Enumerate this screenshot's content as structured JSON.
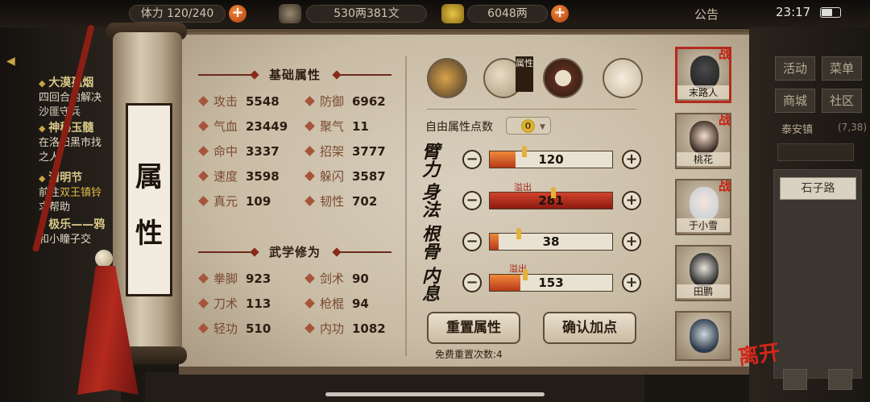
{
  "topbar": {
    "stamina_prefix": "体力",
    "stamina": "120/240",
    "money": "530两381文",
    "gold": "6048两",
    "announcement": "公告",
    "time": "23:17"
  },
  "quests": [
    {
      "title": "大漠孤烟",
      "lines": [
        "四回合内解决",
        "沙匪守兵"
      ]
    },
    {
      "title": "神秘玉髓",
      "lines": [
        "在洛阳黑市找",
        "之人"
      ]
    },
    {
      "title": "清明节",
      "lines": [
        "前往",
        "双王镇铃",
        "求帮助"
      ]
    },
    {
      "title": "极乐——鸦",
      "lines": [
        "和小瞳子交"
      ]
    }
  ],
  "scroll_title": [
    "属",
    "性"
  ],
  "basic": {
    "header": "基础属性",
    "stats": [
      {
        "label": "攻击",
        "value": "5548"
      },
      {
        "label": "防御",
        "value": "6962"
      },
      {
        "label": "气血",
        "value": "23449"
      },
      {
        "label": "聚气",
        "value": "11"
      },
      {
        "label": "命中",
        "value": "3337"
      },
      {
        "label": "招架",
        "value": "3777"
      },
      {
        "label": "速度",
        "value": "3598"
      },
      {
        "label": "躲闪",
        "value": "3587"
      },
      {
        "label": "真元",
        "value": "109"
      },
      {
        "label": "韧性",
        "value": "702"
      }
    ]
  },
  "martial": {
    "header": "武学修为",
    "stats": [
      {
        "label": "拳脚",
        "value": "923"
      },
      {
        "label": "剑术",
        "value": "90"
      },
      {
        "label": "刀术",
        "value": "113"
      },
      {
        "label": "枪棍",
        "value": "94"
      },
      {
        "label": "轻功",
        "value": "510"
      },
      {
        "label": "内功",
        "value": "1082"
      }
    ]
  },
  "tabs": {
    "flag": "属性",
    "icons": [
      "hat-icon",
      "scroll-attr-icon",
      "bagua-icon",
      "body-icon"
    ]
  },
  "points": {
    "label": "自由属性点数",
    "value": "0"
  },
  "attributes": [
    {
      "name": "臂力",
      "value": "120",
      "fill": 0.21,
      "overflow": false
    },
    {
      "name": "身法",
      "value": "281",
      "fill": 1.0,
      "overflow": true,
      "overflow_label": "溢出"
    },
    {
      "name": "根骨",
      "value": "38",
      "fill": 0.07,
      "overflow": false
    },
    {
      "name": "内息",
      "value": "153",
      "fill": 0.25,
      "overflow": true,
      "overflow_label": "溢出"
    }
  ],
  "buttons": {
    "reset": "重置属性",
    "confirm": "确认加点",
    "free_reset": "免费重置次数:4"
  },
  "characters": [
    {
      "name": "末路人",
      "badge": "战",
      "selected": true
    },
    {
      "name": "桃花",
      "badge": "战",
      "selected": false
    },
    {
      "name": "于小雪",
      "badge": "战",
      "selected": false
    },
    {
      "name": "田鹏",
      "badge": "",
      "selected": false
    },
    {
      "name": "",
      "badge": "",
      "selected": false
    }
  ],
  "leave": "离开",
  "side_menu": {
    "activity": "活动",
    "menu": "菜单",
    "shop": "商城",
    "community": "社区",
    "town": "泰安镇",
    "coord": "(7,38)",
    "road": "石子路"
  },
  "colors": {
    "accent": "#b42a1e",
    "bar": "#d9621f",
    "parchment": "#d9cfbd"
  }
}
